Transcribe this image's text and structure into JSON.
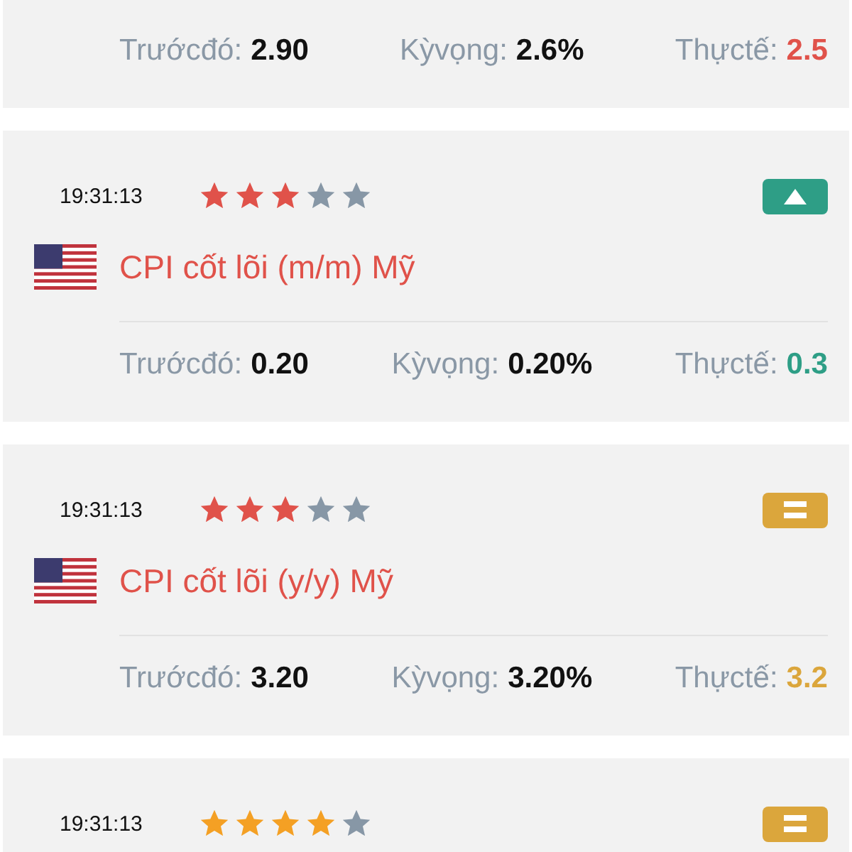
{
  "events": [
    {
      "kind": "down",
      "stats": [
        {
          "label": "Trướcđó:",
          "value": "2.90"
        },
        {
          "label": "Kỳvọng:",
          "value": "2.6%"
        },
        {
          "label": "Thựctế:",
          "value": "2.5",
          "actual": true
        }
      ]
    },
    {
      "kind": "up",
      "time": "19:31:13",
      "stars": 3,
      "title": "CPI cốt lõi (m/m) Mỹ",
      "stats": [
        {
          "label": "Trướcđó:",
          "value": "0.20"
        },
        {
          "label": "Kỳvọng:",
          "value": "0.20%"
        },
        {
          "label": "Thựctế:",
          "value": "0.3",
          "actual": true
        }
      ]
    },
    {
      "kind": "neutral",
      "time": "19:31:13",
      "stars": 3,
      "title": "CPI cốt lõi (y/y) Mỹ",
      "stats": [
        {
          "label": "Trướcđó:",
          "value": "3.20"
        },
        {
          "label": "Kỳvọng:",
          "value": "3.20%"
        },
        {
          "label": "Thựctế:",
          "value": "3.2",
          "actual": true
        }
      ]
    },
    {
      "kind": "neutral",
      "time": "19:31:13",
      "stars": 4
    }
  ]
}
